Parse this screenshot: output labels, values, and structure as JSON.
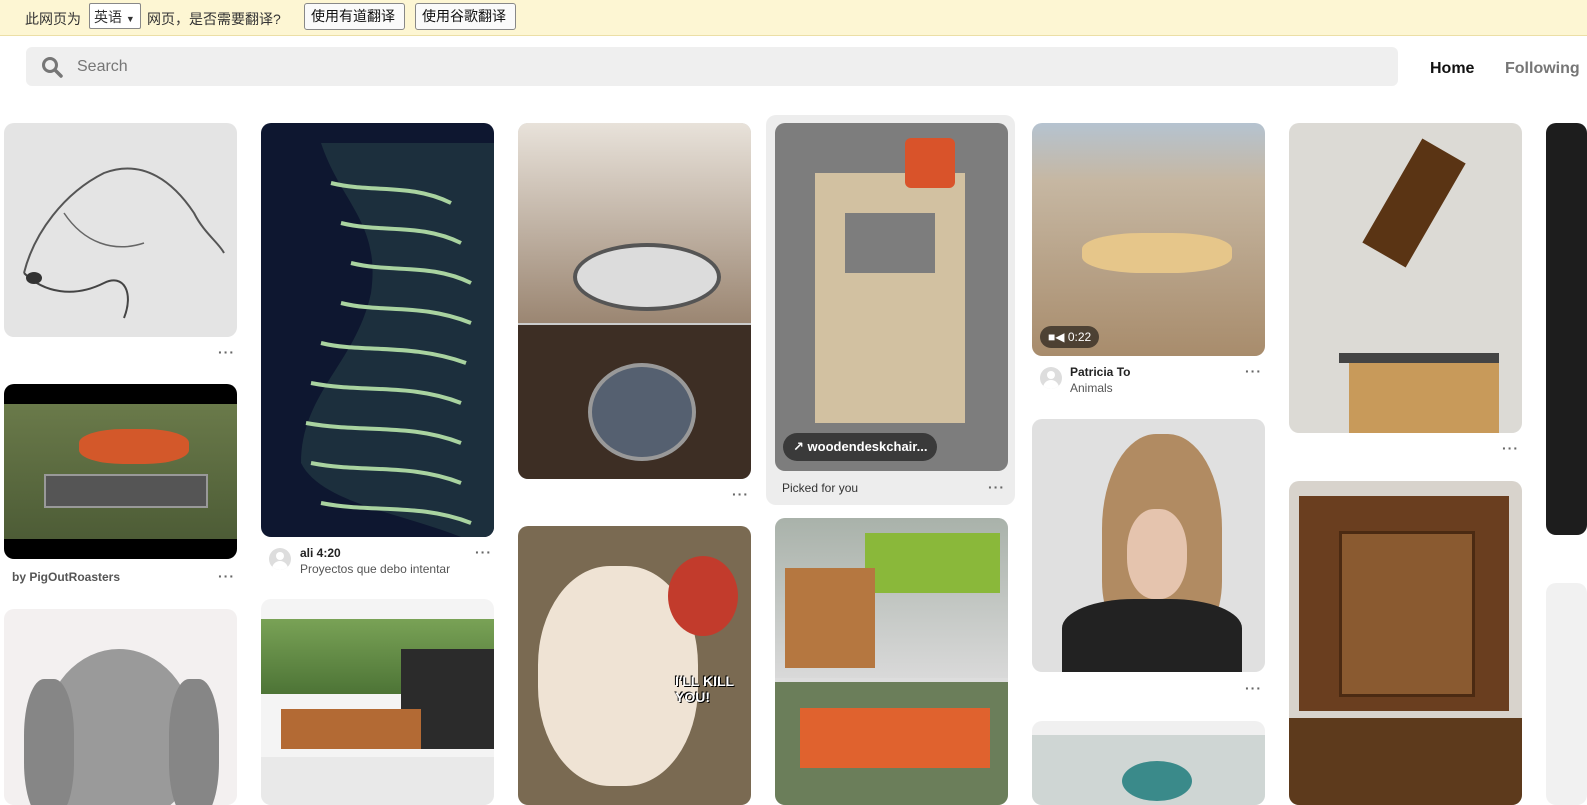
{
  "translate_bar": {
    "prefix": "此网页为",
    "language": "英语",
    "suffix": "网页，是否需要翻译?",
    "youdao_button": "使用有道翻译",
    "google_button": "使用谷歌翻译"
  },
  "header": {
    "search_placeholder": "Search",
    "nav_home": "Home",
    "nav_following": "Following"
  },
  "pins": {
    "roaster_caption": "by PigOutRoasters",
    "ali": {
      "user": "ali 4:20",
      "board": "Proyectos que debo intentar"
    },
    "desk": {
      "link": "woodendeskchair...",
      "note": "Picked for you"
    },
    "lizard": {
      "duration": "0:22",
      "user": "Patricia To",
      "board": "Animals"
    },
    "chihuahua_text": "I'LL KILL YOU!"
  },
  "more_dots": "···",
  "colors": {
    "translate_bar_bg": "#fdf6d3",
    "search_bg": "#efefef",
    "nav_inactive": "#767676"
  }
}
